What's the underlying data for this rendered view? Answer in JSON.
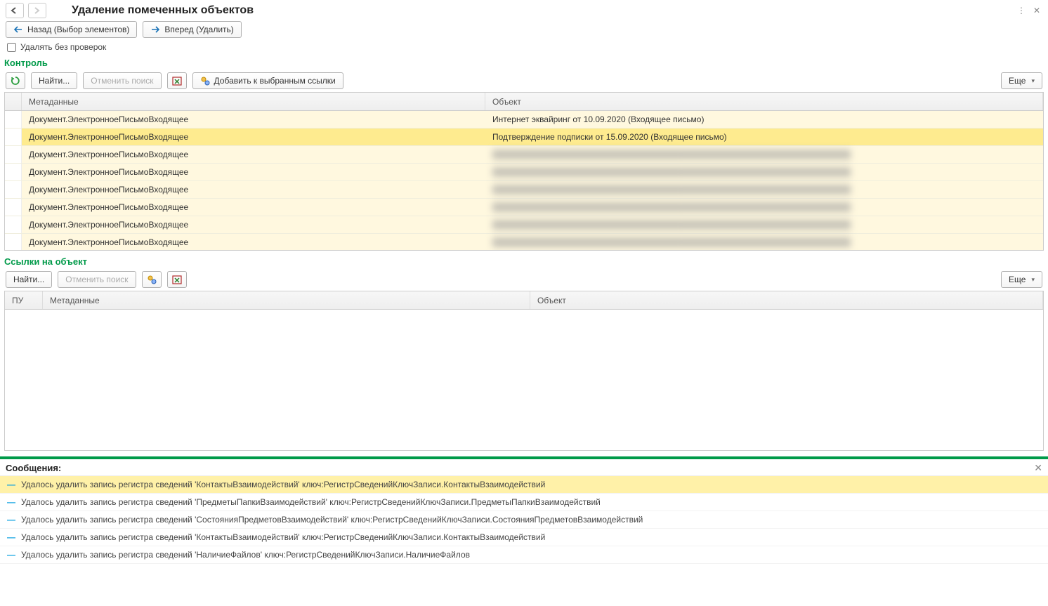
{
  "header": {
    "title": "Удаление помеченных объектов"
  },
  "nav": {
    "back_label": "Назад (Выбор элементов)",
    "forward_label": "Вперед (Удалить)"
  },
  "options": {
    "delete_without_checks_label": "Удалять без проверок"
  },
  "control": {
    "title": "Контроль",
    "find_label": "Найти...",
    "cancel_find_label": "Отменить поиск",
    "add_refs_label": "Добавить к выбранным ссылки",
    "more_label": "Еще",
    "col_meta": "Метаданные",
    "col_obj": "Объект",
    "rows": [
      {
        "meta": "Документ.ЭлектронноеПисьмоВходящее",
        "obj": "Интернет эквайринг от 10.09.2020 (Входящее письмо)",
        "blur": false,
        "selected": false
      },
      {
        "meta": "Документ.ЭлектронноеПисьмоВходящее",
        "obj": "Подтверждение подписки от 15.09.2020 (Входящее письмо)",
        "blur": false,
        "selected": true
      },
      {
        "meta": "Документ.ЭлектронноеПисьмоВходящее",
        "obj": "████████████████████████████████████████████████████████████",
        "blur": true,
        "selected": false
      },
      {
        "meta": "Документ.ЭлектронноеПисьмоВходящее",
        "obj": "████████████████████████████████████████████████████████████",
        "blur": true,
        "selected": false
      },
      {
        "meta": "Документ.ЭлектронноеПисьмоВходящее",
        "obj": "████████████████████████████████████████████████████████████",
        "blur": true,
        "selected": false
      },
      {
        "meta": "Документ.ЭлектронноеПисьмоВходящее",
        "obj": "████████████████████████████████████████████████████████████",
        "blur": true,
        "selected": false
      },
      {
        "meta": "Документ.ЭлектронноеПисьмоВходящее",
        "obj": "████████████████████████████████████████████████████████████",
        "blur": true,
        "selected": false
      },
      {
        "meta": "Документ.ЭлектронноеПисьмоВходящее",
        "obj": "████████████████████████████████████████████████████████████",
        "blur": true,
        "selected": false
      }
    ]
  },
  "refs": {
    "title": "Ссылки на объект",
    "find_label": "Найти...",
    "cancel_find_label": "Отменить поиск",
    "more_label": "Еще",
    "col_pu": "ПУ",
    "col_meta": "Метаданные",
    "col_obj": "Объект",
    "rows": []
  },
  "messages": {
    "title": "Сообщения:",
    "rows": [
      {
        "text": "Удалось удалить запись регистра сведений 'КонтактыВзаимодействий' ключ:РегистрСведенийКлючЗаписи.КонтактыВзаимодействий",
        "selected": true
      },
      {
        "text": "Удалось удалить запись регистра сведений 'ПредметыПапкиВзаимодействий' ключ:РегистрСведенийКлючЗаписи.ПредметыПапкиВзаимодействий",
        "selected": false
      },
      {
        "text": "Удалось удалить запись регистра сведений 'СостоянияПредметовВзаимодействий' ключ:РегистрСведенийКлючЗаписи.СостоянияПредметовВзаимодействий",
        "selected": false
      },
      {
        "text": "Удалось удалить запись регистра сведений 'КонтактыВзаимодействий' ключ:РегистрСведенийКлючЗаписи.КонтактыВзаимодействий",
        "selected": false
      },
      {
        "text": "Удалось удалить запись регистра сведений 'НаличиеФайлов' ключ:РегистрСведенийКлючЗаписи.НаличиеФайлов",
        "selected": false
      }
    ]
  }
}
